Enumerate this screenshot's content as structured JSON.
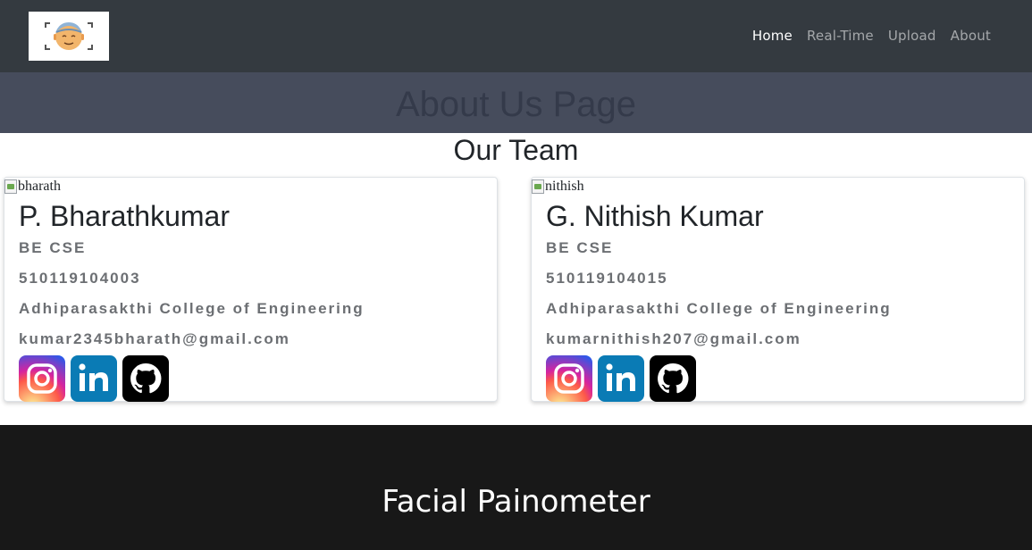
{
  "navbar": {
    "logo_icon": "face-scan-icon",
    "links": [
      {
        "label": "Home",
        "active": true
      },
      {
        "label": "Real-Time",
        "active": false
      },
      {
        "label": "Upload",
        "active": false
      },
      {
        "label": "About",
        "active": false
      }
    ]
  },
  "banner": {
    "title": "About Us Page"
  },
  "team": {
    "title": "Our Team",
    "members": [
      {
        "img_alt": "bharath",
        "name": "P. Bharathkumar",
        "degree": "BE CSE",
        "reg_no": "510119104003",
        "college": "Adhiparasakthi College of Engineering",
        "email": "kumar2345bharath@gmail.com",
        "socials": [
          "instagram-icon",
          "linkedin-icon",
          "github-icon"
        ]
      },
      {
        "img_alt": "nithish",
        "name": "G. Nithish Kumar",
        "degree": "BE CSE",
        "reg_no": "510119104015",
        "college": "Adhiparasakthi College of Engineering",
        "email": "kumarnithish207@gmail.com",
        "socials": [
          "instagram-icon",
          "linkedin-icon",
          "github-icon"
        ]
      }
    ]
  },
  "footer": {
    "title": "Facial Painometer"
  },
  "colors": {
    "navbar_bg": "#343a40",
    "banner_bg": "#464c5c",
    "footer_bg": "#181818",
    "linkedin": "#0a7bb5",
    "github": "#000000"
  }
}
